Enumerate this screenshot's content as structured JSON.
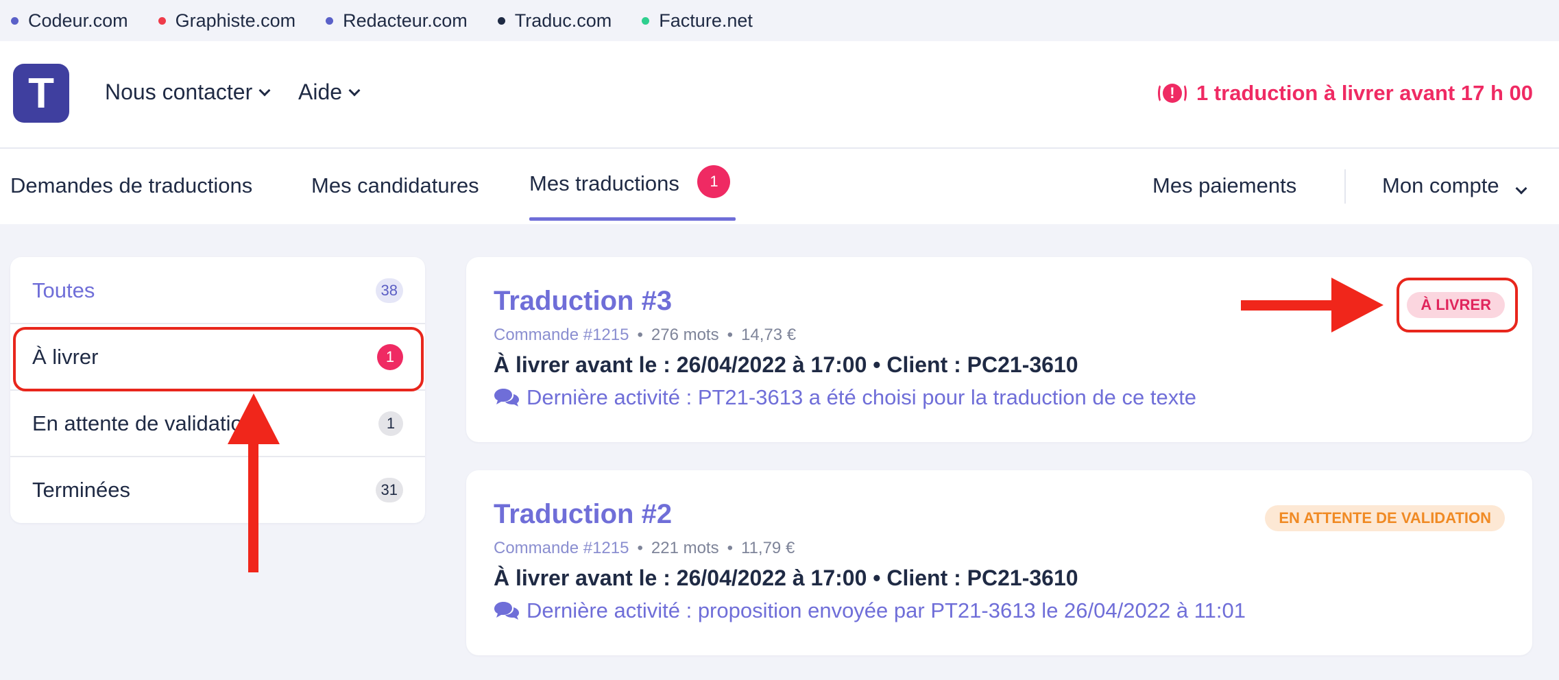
{
  "network_bar": {
    "sites": [
      {
        "label": "Codeur.com",
        "color": "#5a60c8"
      },
      {
        "label": "Graphiste.com",
        "color": "#ef3b4a"
      },
      {
        "label": "Redacteur.com",
        "color": "#5a60c8"
      },
      {
        "label": "Traduc.com",
        "color": "#1f2a44"
      },
      {
        "label": "Facture.net",
        "color": "#2fcf8f"
      }
    ]
  },
  "header": {
    "logo_letter": "T",
    "nav": {
      "contact": "Nous contacter",
      "help": "Aide"
    },
    "alert": {
      "icon_text": "!",
      "text": "1 traduction à livrer avant 17 h 00"
    }
  },
  "tabs": {
    "requests": "Demandes de traductions",
    "applications": "Mes candidatures",
    "translations": "Mes traductions",
    "translations_badge": "1",
    "payments": "Mes paiements",
    "account": "Mon compte"
  },
  "sidebar": {
    "items": [
      {
        "label": "Toutes",
        "count": "38"
      },
      {
        "label": "À livrer",
        "count": "1"
      },
      {
        "label": "En attente de validation",
        "count": "1"
      },
      {
        "label": "Terminées",
        "count": "31"
      }
    ]
  },
  "cards": [
    {
      "title": "Traduction #3",
      "order": "Commande #1215",
      "words": "276 mots",
      "price": "14,73 €",
      "deliver": "À livrer avant le : 26/04/2022 à 17:00  •  Client : PC21-3610",
      "activity": "Dernière activité : PT21-3613 a été choisi pour la traduction de ce texte",
      "status": "À LIVRER"
    },
    {
      "title": "Traduction #2",
      "order": "Commande #1215",
      "words": "221 mots",
      "price": "11,79 €",
      "deliver": "À livrer avant le : 26/04/2022 à 17:00  •  Client : PC21-3610",
      "activity": "Dernière activité : proposition envoyée par PT21-3613 le 26/04/2022 à 11:01",
      "status": "EN ATTENTE DE VALIDATION"
    }
  ],
  "colors": {
    "accent": "#6f6ed8",
    "danger": "#ef2a63",
    "warning": "#f08a24",
    "annotation": "#e8261c"
  }
}
